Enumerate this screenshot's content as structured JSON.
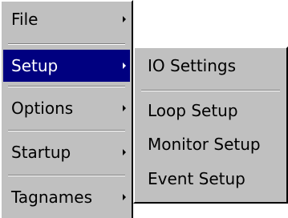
{
  "main_menu": {
    "items": [
      {
        "label": "File",
        "has_submenu": true
      },
      {
        "label": "Setup",
        "has_submenu": true,
        "selected": true
      },
      {
        "label": "Options",
        "has_submenu": true
      },
      {
        "label": "Startup",
        "has_submenu": true
      },
      {
        "label": "Tagnames",
        "has_submenu": true
      }
    ]
  },
  "submenu": {
    "parent": "Setup",
    "items": [
      {
        "label": "IO Settings"
      },
      {
        "label": "Loop Setup"
      },
      {
        "label": "Monitor Setup"
      },
      {
        "label": "Event Setup"
      }
    ]
  },
  "colors": {
    "menu_background": "#c0c0c0",
    "selection_background": "#000080",
    "selection_text": "#ffffff",
    "text": "#000000"
  }
}
